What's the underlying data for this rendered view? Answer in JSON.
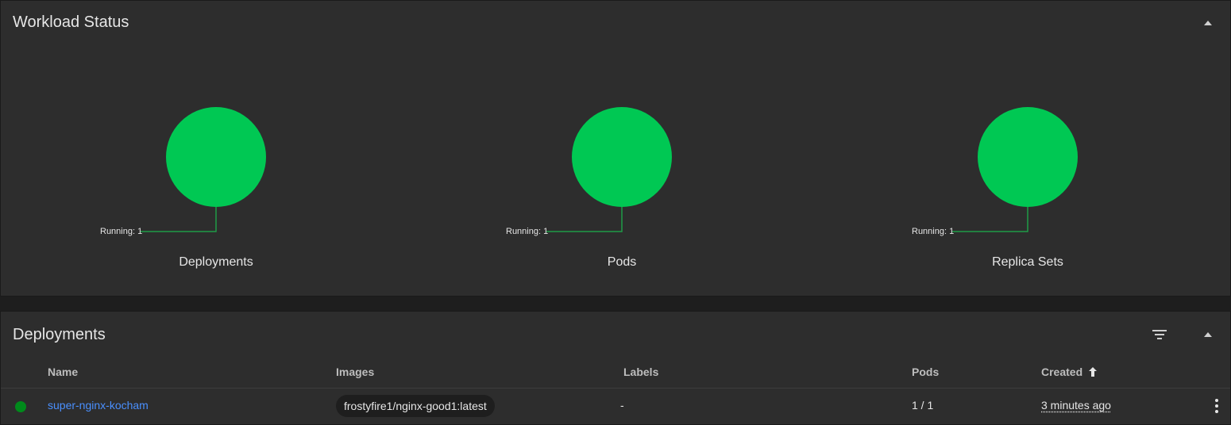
{
  "workload": {
    "title": "Workload Status",
    "charts": [
      {
        "title": "Deployments",
        "legend": "Running: 1",
        "running": 1
      },
      {
        "title": "Pods",
        "legend": "Running: 1",
        "running": 1
      },
      {
        "title": "Replica Sets",
        "legend": "Running: 1",
        "running": 1
      }
    ],
    "colors": {
      "running": "#00c853",
      "leader": "#1f9b47"
    }
  },
  "deployments": {
    "title": "Deployments",
    "columns": {
      "name": "Name",
      "images": "Images",
      "labels": "Labels",
      "pods": "Pods",
      "created": "Created"
    },
    "sort_icon": "arrow-up-icon",
    "rows": [
      {
        "status_color": "#008a1b",
        "name": "super-nginx-kocham",
        "image": "frostyfire1/nginx-good1:latest",
        "labels": "-",
        "pods": "1 / 1",
        "created": "3 minutes ago"
      }
    ]
  }
}
